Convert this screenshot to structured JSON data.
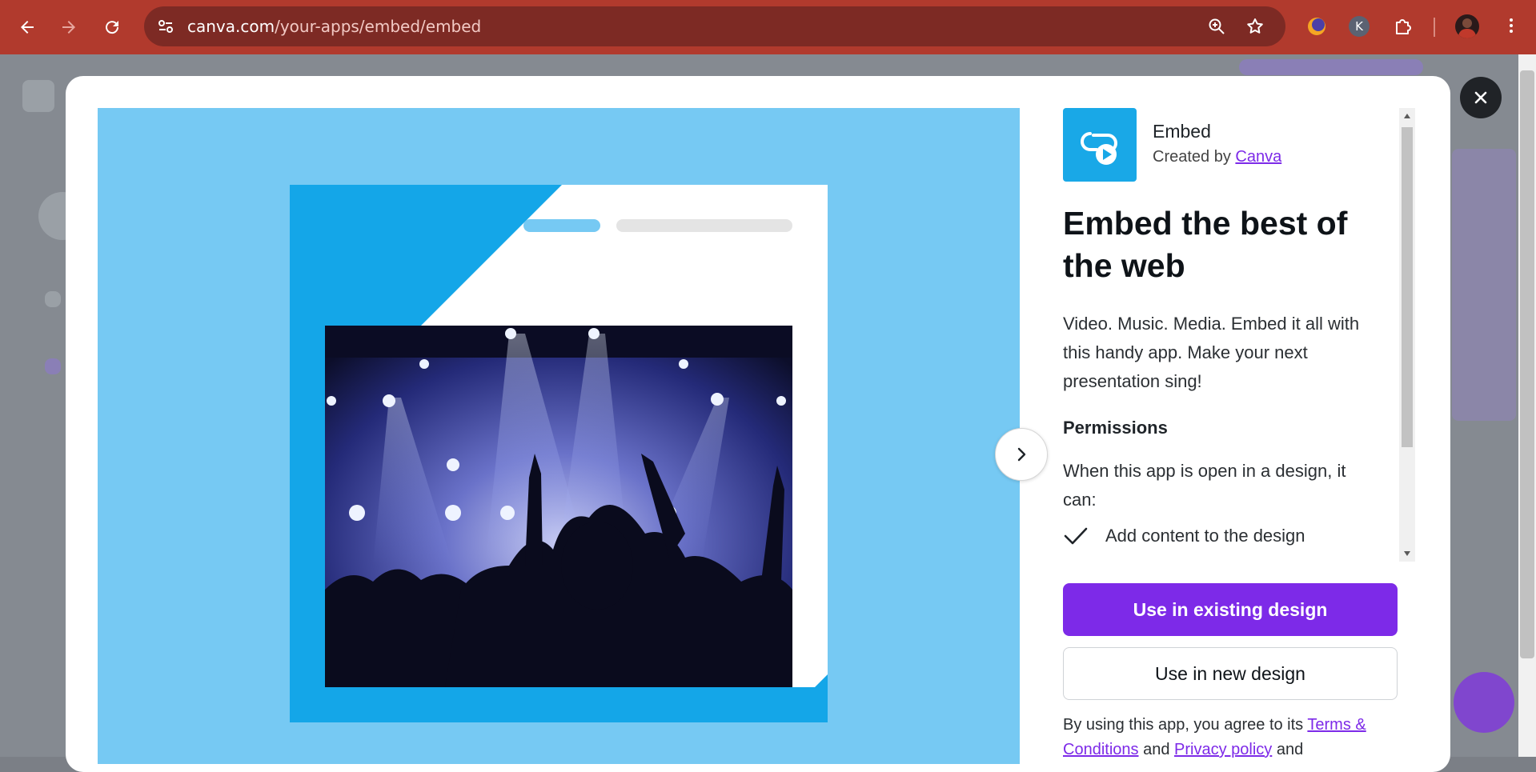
{
  "browser": {
    "url_domain": "canva.com",
    "url_path": "/your-apps/embed/embed",
    "profile_letter": "K"
  },
  "app": {
    "name": "Embed",
    "created_by_prefix": "Created by",
    "creator": "Canva",
    "headline": "Embed the best of the web",
    "description": "Video. Music. Media. Embed it all with this handy app. Make your next presentation sing!",
    "permissions_title": "Permissions",
    "permissions_intro": "When this app is open in a design, it can:",
    "permissions": [
      "Add content to the design"
    ]
  },
  "actions": {
    "primary": "Use in existing design",
    "secondary": "Use in new design"
  },
  "terms": {
    "prefix": "By using this app, you agree to its",
    "terms_link": "Terms & Conditions",
    "and": "and",
    "privacy_link": "Privacy policy",
    "suffix": "and"
  },
  "colors": {
    "brand_purple": "#7d2ae8",
    "hero_bg": "#76c9f3",
    "accent_blue": "#14a6e8",
    "browser_red": "#b13a2d"
  }
}
